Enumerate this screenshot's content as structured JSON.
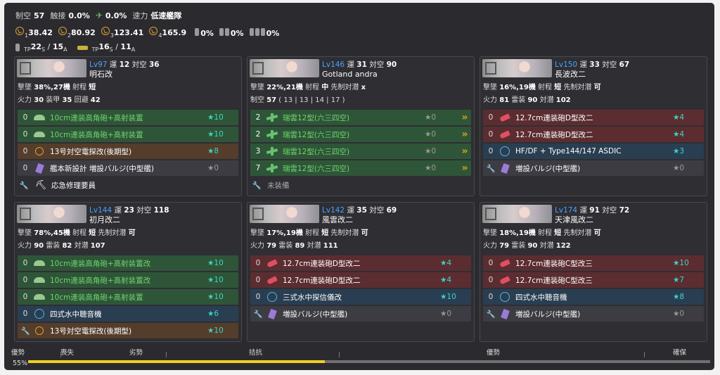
{
  "air": {
    "seiku_label": "制空",
    "seiku_value": "57",
    "shokusetsu_label": "触接",
    "shokusetsu_value": "0.0%",
    "other_value": "0.0%",
    "speed_label": "速力",
    "speed_value": "低速艦隊"
  },
  "los": [
    {
      "prefix": "1",
      "value": "38.42"
    },
    {
      "prefix": "2",
      "value": "80.92"
    },
    {
      "prefix": "3",
      "value": "123.41"
    },
    {
      "prefix": "4",
      "value": "165.9"
    }
  ],
  "drums": [
    "0%",
    "0%",
    "0%"
  ],
  "tp": {
    "a_tp": "TP",
    "a_s": "22",
    "a_ss": "S",
    "a_sep": " / ",
    "a_a": "15",
    "a_aa": "A",
    "b_tp": "TP",
    "b_s": "16",
    "b_ss": "S",
    "b_sep": " / ",
    "b_a": "11",
    "b_aa": "A"
  },
  "ships": [
    {
      "lv": "Lv97",
      "luck_label": "運",
      "luck": "12",
      "aa_label": "対空",
      "aa": "36",
      "name": "明石改",
      "line1": [
        "撃墜 ",
        "38%,27機",
        " 射程 ",
        "短"
      ],
      "line2": [
        "火力 ",
        "30",
        " 装甲 ",
        "35",
        " 回避 ",
        "42"
      ],
      "slots": [
        {
          "count": "0",
          "icon": "gun",
          "label": "10cm連装高角砲+高射装置",
          "star": "★10",
          "color": "green"
        },
        {
          "count": "0",
          "icon": "gun",
          "label": "10cm連装高角砲+高射装置",
          "star": "★10",
          "color": "green"
        },
        {
          "count": "0",
          "icon": "radar",
          "label": "13号対空電探改(後期型)",
          "star": "★8",
          "color": "orange"
        },
        {
          "count": "0",
          "icon": "bulge",
          "label": "艦本新設計 増設バルジ(中型艦)",
          "star": "★0",
          "color": "gray"
        }
      ],
      "ex": "応急修理要員"
    },
    {
      "lv": "Lv146",
      "luck_label": "運",
      "luck": "31",
      "aa_label": "対空",
      "aa": "90",
      "name": "Gotland andra",
      "line1": [
        "撃墜 ",
        "22%,21機",
        " 射程 ",
        "中",
        " 先制対潜 ",
        "x"
      ],
      "line2": [
        "制空 ",
        "57",
        " ( 13 | 13 | 14 | 17 )"
      ],
      "slots": [
        {
          "count": "2",
          "icon": "plane",
          "label": "瑞雲12型(六三四空)",
          "star": "★0",
          "color": "green",
          "prof": "»"
        },
        {
          "count": "2",
          "icon": "plane",
          "label": "瑞雲12型(六三四空)",
          "star": "★0",
          "color": "green",
          "prof": "»"
        },
        {
          "count": "3",
          "icon": "plane",
          "label": "瑞雲12型(六三四空)",
          "star": "★0",
          "color": "green",
          "prof": "»"
        },
        {
          "count": "7",
          "icon": "plane",
          "label": "瑞雲12型(六三四空)",
          "star": "★0",
          "color": "green",
          "prof": "»"
        }
      ],
      "ex": "未装備"
    },
    {
      "lv": "Lv150",
      "luck_label": "運",
      "luck": "33",
      "aa_label": "対空",
      "aa": "67",
      "name": "長波改二",
      "line1": [
        "撃墜 ",
        "16%,19機",
        " 射程 ",
        "短",
        " 先制対潜 ",
        "可"
      ],
      "line2": [
        "火力 ",
        "81",
        " 雷装 ",
        "90",
        " 対潜 ",
        "102"
      ],
      "slots": [
        {
          "count": "0",
          "icon": "redgun",
          "label": "12.7cm連装砲D型改二",
          "star": "★4",
          "color": "red"
        },
        {
          "count": "0",
          "icon": "redgun",
          "label": "12.7cm連装砲D型改二",
          "star": "★4",
          "color": "red"
        },
        {
          "count": "0",
          "icon": "sonar",
          "label": "HF/DF + Type144/147 ASDIC",
          "star": "★3",
          "color": "blue"
        }
      ],
      "ex": "増設バルジ(中型艦)",
      "exstar": "★0"
    },
    {
      "lv": "Lv144",
      "luck_label": "運",
      "luck": "23",
      "aa_label": "対空",
      "aa": "118",
      "name": "初月改二",
      "line1": [
        "撃墜 ",
        "78%,45機",
        " 射程 ",
        "短",
        " 先制対潜 ",
        "可"
      ],
      "line2": [
        "火力 ",
        "90",
        " 雷装 ",
        "82",
        " 対潜 ",
        "107"
      ],
      "slots": [
        {
          "count": "0",
          "icon": "gun",
          "label": "10cm連装高角砲+高射装置改",
          "star": "★10",
          "color": "green"
        },
        {
          "count": "0",
          "icon": "gun",
          "label": "10cm連装高角砲+高射装置改",
          "star": "★10",
          "color": "green"
        },
        {
          "count": "0",
          "icon": "gun",
          "label": "10cm連装高角砲+高射装置",
          "star": "★10",
          "color": "green"
        },
        {
          "count": "0",
          "icon": "sonar",
          "label": "四式水中聴音機",
          "star": "★6",
          "color": "blue"
        }
      ],
      "ex": "13号対空電探改(後期型)",
      "exstar": "★10",
      "exicon": "radar"
    },
    {
      "lv": "Lv142",
      "luck_label": "運",
      "luck": "35",
      "aa_label": "対空",
      "aa": "69",
      "name": "風雲改二",
      "line1": [
        "撃墜 ",
        "17%,19機",
        " 射程 ",
        "短",
        " 先制対潜 ",
        "可"
      ],
      "line2": [
        "火力 ",
        "79",
        " 雷装 ",
        "89",
        " 対潜 ",
        "111"
      ],
      "slots": [
        {
          "count": "0",
          "icon": "redgun",
          "label": "12.7cm連装砲D型改二",
          "star": "★4",
          "color": "red"
        },
        {
          "count": "0",
          "icon": "redgun",
          "label": "12.7cm連装砲D型改二",
          "star": "★4",
          "color": "red"
        },
        {
          "count": "0",
          "icon": "sonar",
          "label": "三式水中探信儀改",
          "star": "★10",
          "color": "blue"
        }
      ],
      "ex": "増設バルジ(中型艦)",
      "exstar": "★0"
    },
    {
      "lv": "Lv174",
      "luck_label": "運",
      "luck": "91",
      "aa_label": "対空",
      "aa": "72",
      "name": "天津風改二",
      "line1": [
        "撃墜 ",
        "18%,19機",
        " 射程 ",
        "短",
        " 先制対潜 ",
        "可"
      ],
      "line2": [
        "火力 ",
        "79",
        " 雷装 ",
        "90",
        " 対潜 ",
        "122"
      ],
      "slots": [
        {
          "count": "0",
          "icon": "redgun",
          "label": "12.7cm連装砲C型改三",
          "star": "★10",
          "color": "red"
        },
        {
          "count": "0",
          "icon": "redgun",
          "label": "12.7cm連装砲C型改三",
          "star": "★7",
          "color": "red"
        },
        {
          "count": "0",
          "icon": "sonar",
          "label": "四式水中聴音機",
          "star": "★8",
          "color": "blue"
        }
      ],
      "ex": "増設バルジ(中型艦)",
      "exstar": "★0"
    }
  ],
  "airbar": {
    "label": "優勢",
    "percent": "55%",
    "fill_fraction": 0.435,
    "stages": [
      "喪失",
      "劣勢",
      "拮抗",
      "優勢",
      "確保"
    ]
  }
}
